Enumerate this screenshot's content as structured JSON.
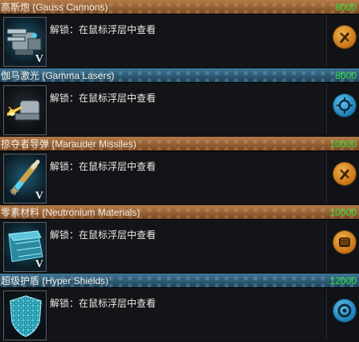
{
  "techs": [
    {
      "name": "高斯炮 (Gauss Cannons)",
      "cost": "8000",
      "unlock_text": "解锁：在鼠标浮层中查看",
      "icon": "gauss-cannon-icon",
      "header_color": "orange",
      "badge_icon": "weapons-badge-icon",
      "badge_color": "orange",
      "level_mark": "V"
    },
    {
      "name": "伽马激光 (Gamma Lasers)",
      "cost": "8000",
      "unlock_text": "解锁：在鼠标浮层中查看",
      "icon": "gamma-laser-icon",
      "header_color": "blue",
      "badge_icon": "laser-badge-icon",
      "badge_color": "blue",
      "level_mark": ""
    },
    {
      "name": "掠夺者导弹 (Marauder Missiles)",
      "cost": "10000",
      "unlock_text": "解锁：在鼠标浮层中查看",
      "icon": "missile-icon",
      "header_color": "orange",
      "badge_icon": "weapons-badge-icon",
      "badge_color": "orange",
      "level_mark": "V"
    },
    {
      "name": "零素材料 (Neutronium Materials)",
      "cost": "10000",
      "unlock_text": "解锁：在鼠标浮层中查看",
      "icon": "armor-material-icon",
      "header_color": "orange",
      "badge_icon": "fist-badge-icon",
      "badge_color": "orange",
      "level_mark": "V"
    },
    {
      "name": "超级护盾 (Hyper Shields)",
      "cost": "12000",
      "unlock_text": "解锁：在鼠标浮层中查看",
      "icon": "shield-icon",
      "header_color": "blue",
      "badge_icon": "shield-badge-icon",
      "badge_color": "blue",
      "level_mark": ""
    }
  ],
  "colors": {
    "cost_green": "#2ee63a",
    "header_orange": "#9a6336",
    "header_blue": "#2f5c78"
  }
}
